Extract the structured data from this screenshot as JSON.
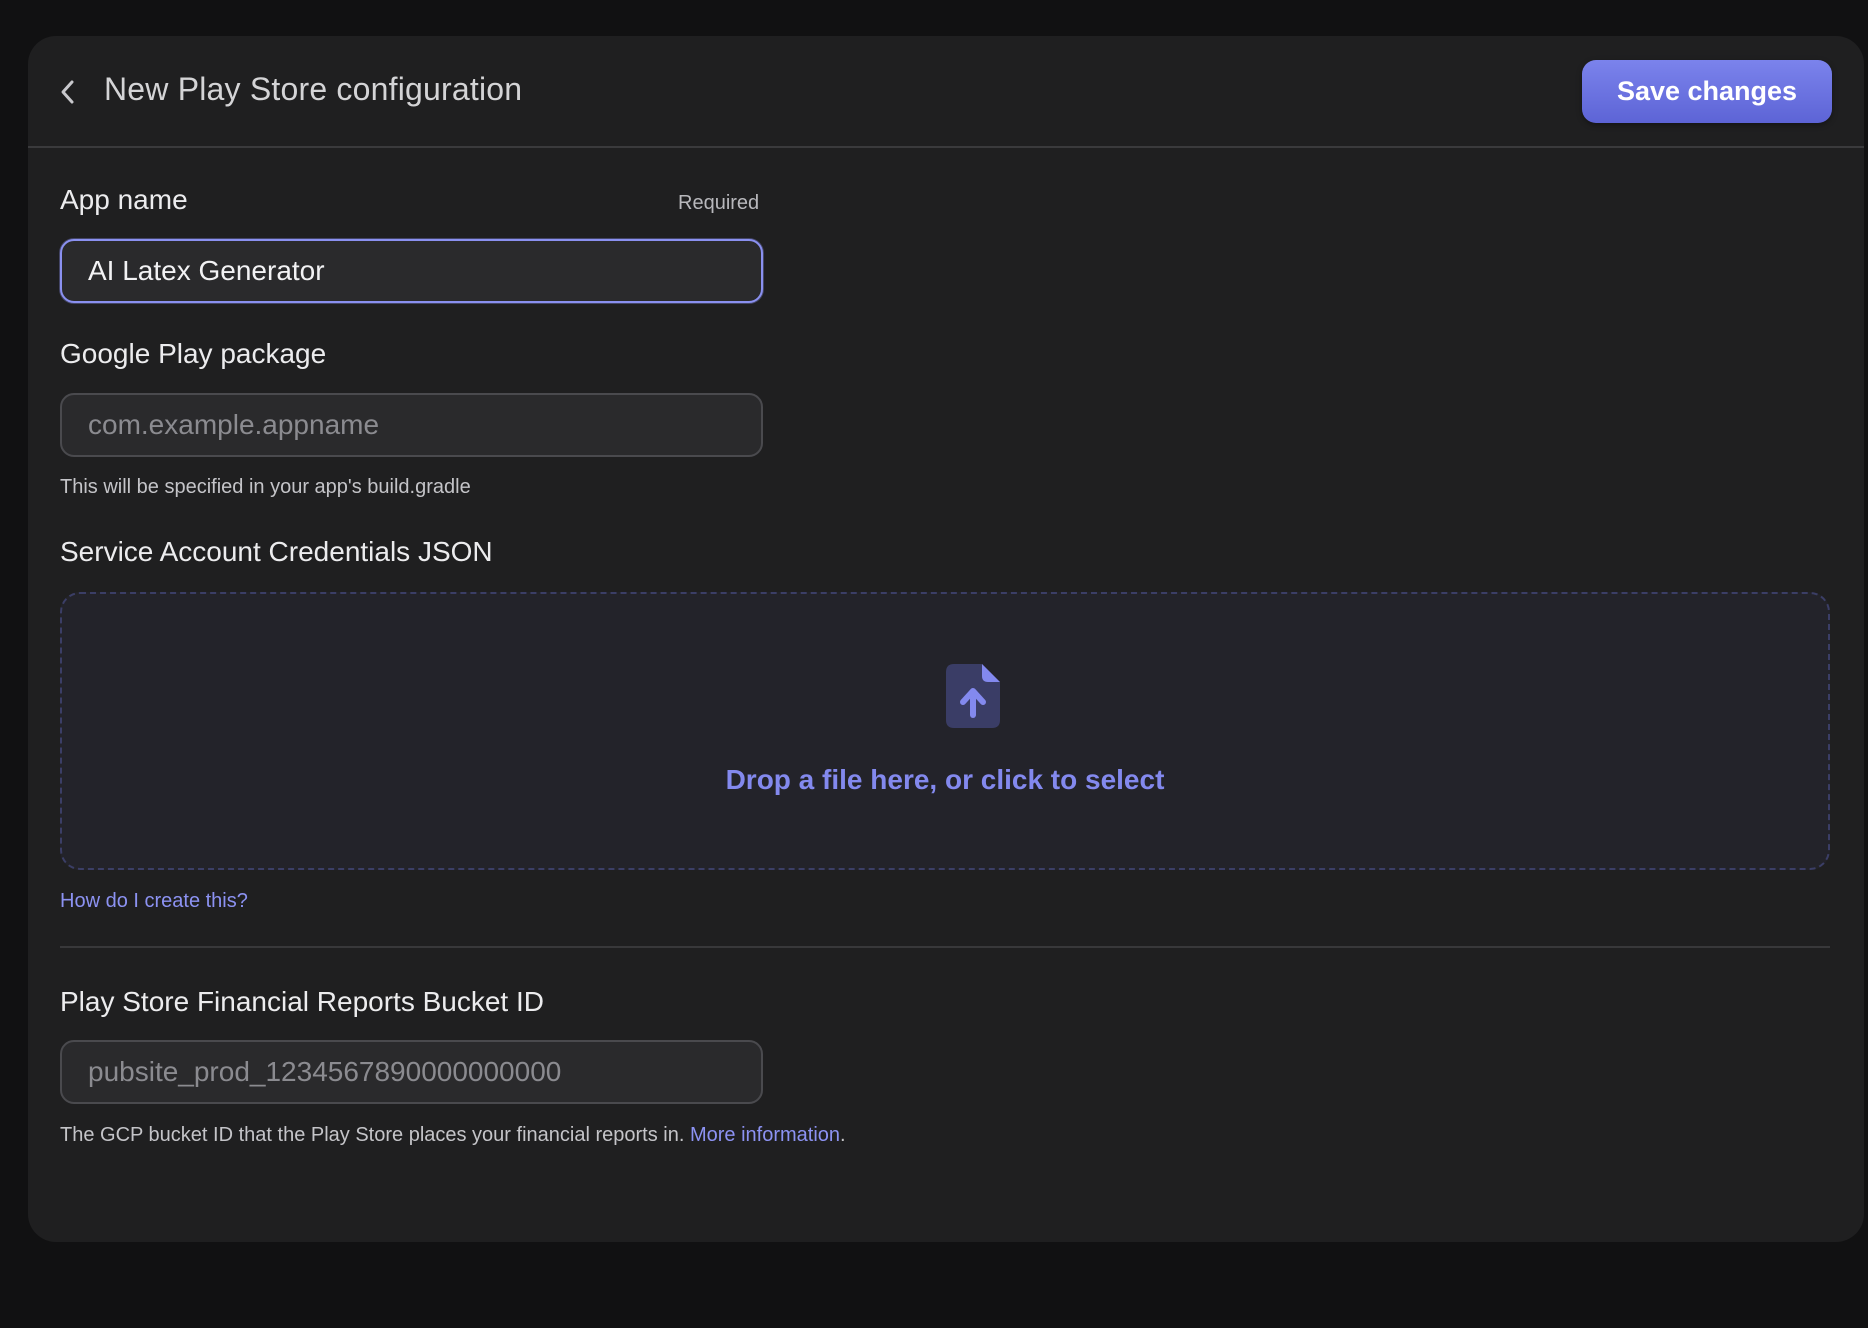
{
  "header": {
    "title": "New Play Store configuration",
    "save_label": "Save changes"
  },
  "app_name": {
    "label": "App name",
    "required_label": "Required",
    "value": "AI Latex Generator"
  },
  "package": {
    "label": "Google Play package",
    "placeholder": "com.example.appname",
    "helper": "This will be specified in your app's build.gradle"
  },
  "credentials": {
    "label": "Service Account Credentials JSON",
    "dropzone_text": "Drop a file here, or click to select",
    "help_link": "How do I create this?"
  },
  "bucket": {
    "label": "Play Store Financial Reports Bucket ID",
    "placeholder": "pubsite_prod_1234567890000000000",
    "helper": "The GCP bucket ID that the Play Store places your financial reports in.",
    "helper_link": "More information",
    "helper_suffix": "."
  },
  "colors": {
    "accent": "#7b83ec",
    "link": "#8c92f2",
    "background": "#111112",
    "card": "#1f1f20"
  },
  "icons": {
    "back": "chevron-left-icon",
    "upload": "file-upload-icon"
  }
}
